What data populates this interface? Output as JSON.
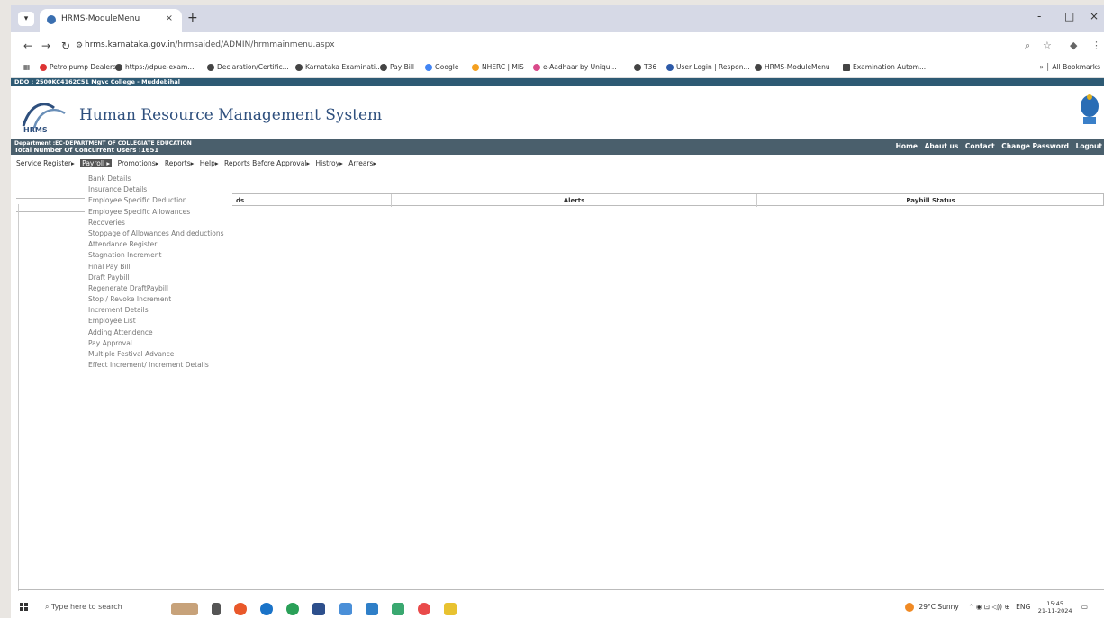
{
  "browser": {
    "tab_title": "HRMS-ModuleMenu",
    "tab_close": "×",
    "new_tab": "+",
    "url_host": "hrms.karnataka.gov.in",
    "url_path": "/hrmsaided/ADMIN/hrmmainmenu.aspx",
    "window_controls": [
      "-",
      "□",
      "×"
    ],
    "bookmarks": [
      "Petrolpump Dealers",
      "https://dpue-exam...",
      "Declaration/Certific...",
      "Karnataka Examinati...",
      "Pay Bill",
      "Google",
      "NHERC | MIS",
      "e-Aadhaar by Uniqu...",
      "T36",
      "User Login | Respon...",
      "HRMS-ModuleMenu",
      "Examination Autom..."
    ],
    "all_bookmarks": "All Bookmarks"
  },
  "header": {
    "ddo_line": "DDO : 2500KC4162C51  Mgvc College - Muddebihal",
    "system_title": "Human Resource Management System",
    "logo_text": "HRMS",
    "department": "Department :EC-DEPARTMENT OF COLLEGIATE EDUCATION",
    "concurrent_users": "Total Number Of Concurrent Users :1651",
    "links": [
      "Home",
      "About us",
      "Contact",
      "Change Password",
      "Logout"
    ]
  },
  "menu": {
    "items": [
      "Service Register",
      "Payroll",
      "Promotions",
      "Reports",
      "Help",
      "Reports Before Approval",
      "Histroy",
      "Arrears"
    ],
    "active": "Payroll"
  },
  "dropdown": {
    "items": [
      "Bank Details",
      "Insurance Details",
      "Employee Specific Deduction",
      "Employee Specific Allowances",
      "Recoveries",
      "Stoppage of Allowances And deductions",
      "Attendance Register",
      "Stagnation Increment",
      "Final Pay Bill",
      "Draft Paybill",
      "Regenerate DraftPaybill",
      "Stop / Revoke Increment",
      "Increment Details",
      "Employee List",
      "Adding Attendence",
      "Pay Approval",
      "Multiple Festival Advance",
      "Effect Increment/ Increment Details"
    ]
  },
  "grid": {
    "col1": "ds",
    "col2": "Alerts",
    "col3": "Paybill Status"
  },
  "taskbar": {
    "search_placeholder": "Type here to search",
    "weather": "29°C  Sunny",
    "lang": "ENG",
    "time": "15:45",
    "date": "21-11-2024"
  },
  "colors": {
    "header_bar": "#2e5a74",
    "info_bar": "#4a5f6c",
    "title_blue": "#2e4f7d",
    "active_menu": "#555555"
  }
}
